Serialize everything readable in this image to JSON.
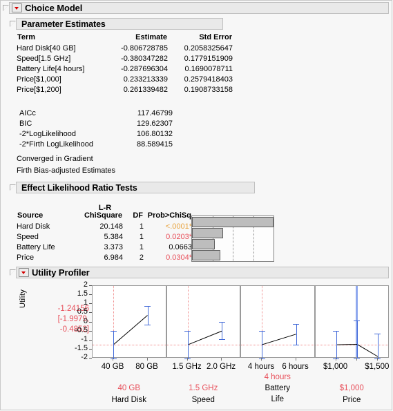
{
  "window": {
    "sections": {
      "choice_model": "Choice Model",
      "parameter_estimates": "Parameter Estimates",
      "effect_lrt": "Effect Likelihood Ratio Tests",
      "utility_profiler": "Utility Profiler"
    },
    "icons": {
      "red_triangle": "red-triangle-menu-icon",
      "disclosure": "disclosure-triangle-icon"
    }
  },
  "parameter_estimates": {
    "columns": [
      "Term",
      "Estimate",
      "Std Error"
    ],
    "rows": [
      {
        "term": "Hard Disk[40 GB]",
        "estimate": "-0.806728785",
        "std_error": "0.2058325647"
      },
      {
        "term": "Speed[1.5 GHz]",
        "estimate": "-0.380347282",
        "std_error": "0.1779151909"
      },
      {
        "term": "Battery Life[4 hours]",
        "estimate": "-0.287696304",
        "std_error": "0.1690078711"
      },
      {
        "term": "Price[$1,000]",
        "estimate": "0.233213339",
        "std_error": "0.2579418403"
      },
      {
        "term": "Price[$1,200]",
        "estimate": "0.261339482",
        "std_error": "0.1908733158"
      }
    ],
    "fit_statistics": [
      {
        "label": "AICc",
        "value": "117.46799"
      },
      {
        "label": "BIC",
        "value": "129.62307"
      },
      {
        "label": "-2*LogLikelihood",
        "value": "106.80132"
      },
      {
        "label": "-2*Firth LogLikelihood",
        "value": "88.589415"
      }
    ],
    "notes": [
      "Converged in Gradient",
      "Firth Bias-adjusted Estimates"
    ]
  },
  "effect_lrt": {
    "group_header": "L-R",
    "columns": [
      "Source",
      "ChiSquare",
      "DF",
      "Prob>ChiSq"
    ],
    "rows": [
      {
        "source": "Hard Disk",
        "chisquare": "20.148",
        "df": "1",
        "prob": "<.0001*",
        "sig": "high",
        "bar_pct": 100
      },
      {
        "source": "Speed",
        "chisquare": "5.384",
        "df": "1",
        "prob": "0.0203*",
        "sig": "yes",
        "bar_pct": 38
      },
      {
        "source": "Battery Life",
        "chisquare": "3.373",
        "df": "1",
        "prob": "0.0663",
        "sig": "no",
        "bar_pct": 28
      },
      {
        "source": "Price",
        "chisquare": "6.984",
        "df": "2",
        "prob": "0.0304*",
        "sig": "yes",
        "bar_pct": 35
      }
    ],
    "chart": {
      "gridlines": 3,
      "axis_note": "p-value significance bars"
    }
  },
  "utility_profiler": {
    "y_axis_label": "Utility",
    "current_utility": "-1.24156",
    "ci_lower_line": "[-1.9979,",
    "ci_upper_line": "-0.4852]",
    "y_ticks": [
      "2",
      "1.5",
      "1",
      "0.5",
      "0",
      "-0.5",
      "-1",
      "-1.5",
      "-2"
    ],
    "y_min": -2,
    "y_max": 2,
    "reference_utility": -1.24156,
    "panels": [
      {
        "factor": "Hard Disk",
        "factor_lines": [
          "Hard Disk"
        ],
        "current_value": "40 GB",
        "current_label_above": false,
        "levels": [
          "40 GB",
          "80 GB"
        ],
        "utilities": [
          -1.24156,
          0.38
        ],
        "ci_low": [
          -2.0,
          -0.15
        ],
        "ci_high": [
          -0.485,
          0.9
        ],
        "current_index": 0
      },
      {
        "factor": "Speed",
        "factor_lines": [
          "Speed"
        ],
        "current_value": "1.5 GHz",
        "current_label_above": false,
        "levels": [
          "1.5 GHz",
          "2.0 GHz"
        ],
        "utilities": [
          -1.24156,
          -0.48
        ],
        "ci_low": [
          -2.0,
          -0.95
        ],
        "ci_high": [
          -0.49,
          0.02
        ],
        "current_index": 0
      },
      {
        "factor": "Battery Life",
        "factor_lines": [
          "Battery",
          "Life"
        ],
        "current_value": "4 hours",
        "current_label_above": true,
        "levels": [
          "4 hours",
          "6 hours"
        ],
        "utilities": [
          -1.24156,
          -0.66
        ],
        "ci_low": [
          -2.0,
          -1.24
        ],
        "ci_high": [
          -0.49,
          -0.08
        ],
        "current_index": 0
      },
      {
        "factor": "Price",
        "factor_lines": [
          "Price"
        ],
        "current_value": "$1,000",
        "current_label_above": false,
        "levels": [
          "$1,000",
          "$1,500"
        ],
        "price_points": [
          "$1,000",
          "$1,200",
          "$1,500"
        ],
        "utilities": [
          -1.24156,
          -1.22,
          -1.9
        ],
        "ci_low": [
          -2.0,
          -1.95,
          -2.0
        ],
        "ci_high": [
          -0.49,
          0.1,
          -0.62
        ],
        "current_index": 1
      }
    ]
  }
}
